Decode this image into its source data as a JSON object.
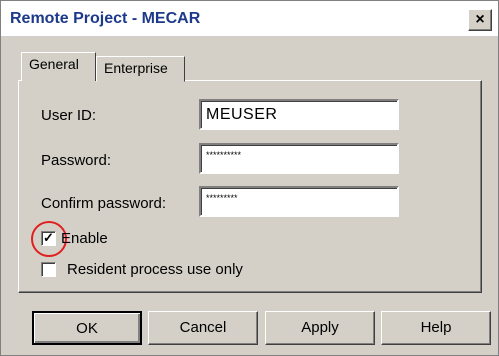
{
  "window": {
    "title": "Remote Project - MECAR",
    "close_glyph": "×"
  },
  "tabs": [
    {
      "label": "General",
      "active": true
    },
    {
      "label": "Enterprise",
      "active": false
    }
  ],
  "form": {
    "user_id": {
      "label": "User ID:",
      "value": "MEUSER"
    },
    "password": {
      "label": "Password:",
      "value": "**********"
    },
    "confirm_password": {
      "label": "Confirm password:",
      "value": "*********"
    },
    "enable": {
      "label": "Enable",
      "checked": true,
      "check_glyph": "✓"
    },
    "resident_only": {
      "label": "Resident process use only",
      "checked": false
    }
  },
  "buttons": {
    "ok": "OK",
    "cancel": "Cancel",
    "apply": "Apply",
    "help": "Help"
  },
  "colors": {
    "title": "#1d3a8a",
    "highlight_ring": "#e02020",
    "dialog_bg": "#d4d0c8"
  }
}
